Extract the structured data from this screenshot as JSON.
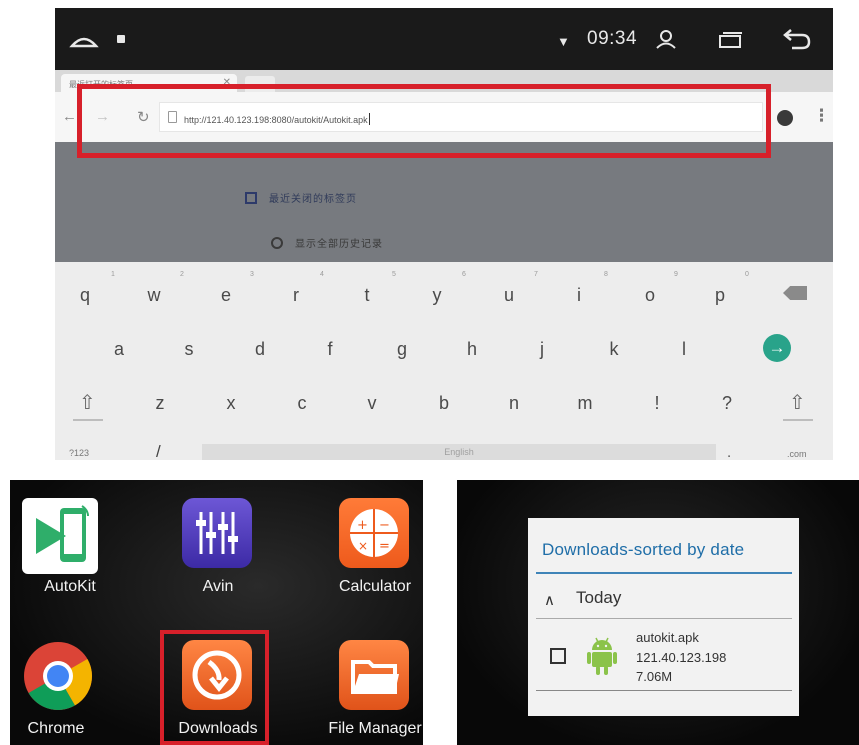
{
  "browser": {
    "status_bar": {
      "time": "09:34"
    },
    "tab_title": "最近打开的标签页",
    "url": "http://121.40.123.198:8080/autokit/Autokit.apk",
    "suggestions": [
      "最近关闭的标签页",
      "显示全部历史记录"
    ]
  },
  "keyboard": {
    "row1": [
      "q",
      "w",
      "e",
      "r",
      "t",
      "y",
      "u",
      "i",
      "o",
      "p"
    ],
    "row1_hints": [
      "1",
      "2",
      "3",
      "4",
      "5",
      "6",
      "7",
      "8",
      "9",
      "0"
    ],
    "row2": [
      "a",
      "s",
      "d",
      "f",
      "g",
      "h",
      "j",
      "k",
      "l"
    ],
    "row3": [
      "z",
      "x",
      "c",
      "v",
      "b",
      "n",
      "m",
      "!",
      "?"
    ],
    "symbols_key": "?123",
    "slash_key": "/",
    "space_label": "English",
    "dot_key": ".",
    "com_key": ".com"
  },
  "home_screen": {
    "apps": [
      "AutoKit",
      "Avin",
      "Calculator",
      "Chrome",
      "Downloads",
      "File Manager"
    ]
  },
  "downloads_window": {
    "title": "Downloads-sorted by date",
    "group": "Today",
    "item": {
      "name": "autokit.apk",
      "source": "121.40.123.198",
      "size": "7.06M"
    }
  },
  "colors": {
    "highlight": "#d7202a",
    "accent_blue": "#1f6ea8",
    "enter_key": "#29a38a",
    "android_green": "#8bc34a",
    "app_orange": "#f06425",
    "avin_purple": "#5540c4"
  },
  "icons": [
    "home-icon",
    "wifi-icon",
    "user-icon",
    "window-icon",
    "back-icon",
    "refresh-icon",
    "backspace-icon",
    "enter-icon",
    "shift-icon",
    "chevron-up-icon",
    "android-icon",
    "chrome-icon",
    "folder-icon",
    "calculator-icon",
    "download-arrow-icon"
  ]
}
